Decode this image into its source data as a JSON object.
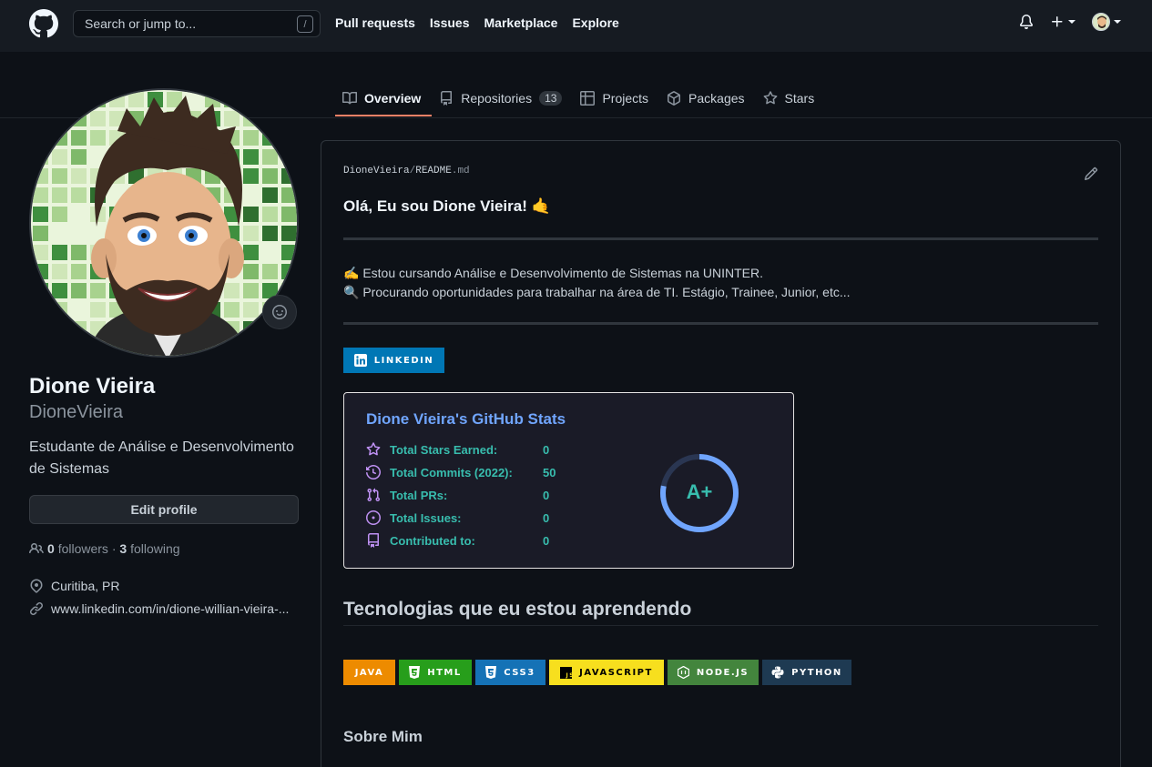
{
  "header": {
    "search_placeholder": "Search or jump to...",
    "search_key": "/",
    "nav": [
      "Pull requests",
      "Issues",
      "Marketplace",
      "Explore"
    ]
  },
  "tabs": [
    {
      "label": "Overview",
      "icon": "book-icon",
      "active": true
    },
    {
      "label": "Repositories",
      "icon": "repo-icon",
      "count": "13"
    },
    {
      "label": "Projects",
      "icon": "project-icon"
    },
    {
      "label": "Packages",
      "icon": "package-icon"
    },
    {
      "label": "Stars",
      "icon": "star-icon"
    }
  ],
  "profile": {
    "name": "Dione Vieira",
    "username": "DioneVieira",
    "bio": "Estudante de Análise e Desenvolvimento de Sistemas",
    "edit_label": "Edit profile",
    "followers_count": "0",
    "followers_label": "followers",
    "separator": "·",
    "following_count": "3",
    "following_label": "following",
    "location": "Curitiba, PR",
    "website": "www.linkedin.com/in/dione-willian-vieira-..."
  },
  "readme": {
    "owner": "DioneVieira",
    "slash": "/",
    "file": "README",
    "ext": ".md",
    "heading": "Olá, Eu sou Dione Vieira! 🤙",
    "line1": "✍️ Estou cursando Análise e Desenvolvimento de Sistemas na UNINTER.",
    "line2": "🔍 Procurando oportunidades para trabalhar na área de TI. Estágio, Trainee, Junior, etc...",
    "linkedin_badge": "LINKEDIN",
    "tech_heading": "Tecnologias que eu estou aprendendo",
    "about_heading": "Sobre Mim"
  },
  "stats": {
    "title": "Dione Vieira's GitHub Stats",
    "rows": [
      {
        "label": "Total Stars Earned:",
        "value": "0",
        "icon": "star-outline-icon"
      },
      {
        "label": "Total Commits (2022):",
        "value": "50",
        "icon": "history-icon"
      },
      {
        "label": "Total PRs:",
        "value": "0",
        "icon": "pull-request-icon"
      },
      {
        "label": "Total Issues:",
        "value": "0",
        "icon": "issue-icon"
      },
      {
        "label": "Contributed to:",
        "value": "0",
        "icon": "repo-icon"
      }
    ],
    "rank": "A+",
    "rank_progress": 0.78,
    "colors": {
      "title": "#70a5fd",
      "text": "#38bdae",
      "icon": "#bf91f3",
      "bg": "#1a1b27"
    }
  },
  "tech_badges": [
    {
      "label": "JAVA",
      "color": "#ed8b00"
    },
    {
      "label": "HTML",
      "color": "#e34f26",
      "icon": "html5-icon"
    },
    {
      "label": "CSS3",
      "color": "#1572b6",
      "icon": "css3-icon"
    },
    {
      "label": "JAVASCRIPT",
      "color": "#f7df1e",
      "icon": "js-icon"
    },
    {
      "label": "NODE.JS",
      "color": "#43853d",
      "icon": "nodejs-icon"
    },
    {
      "label": "PYTHON",
      "color": "#3670a0",
      "icon": "python-icon"
    }
  ],
  "colors": {
    "accent_tab": "#f78166",
    "linkedin": "#0077b5"
  }
}
